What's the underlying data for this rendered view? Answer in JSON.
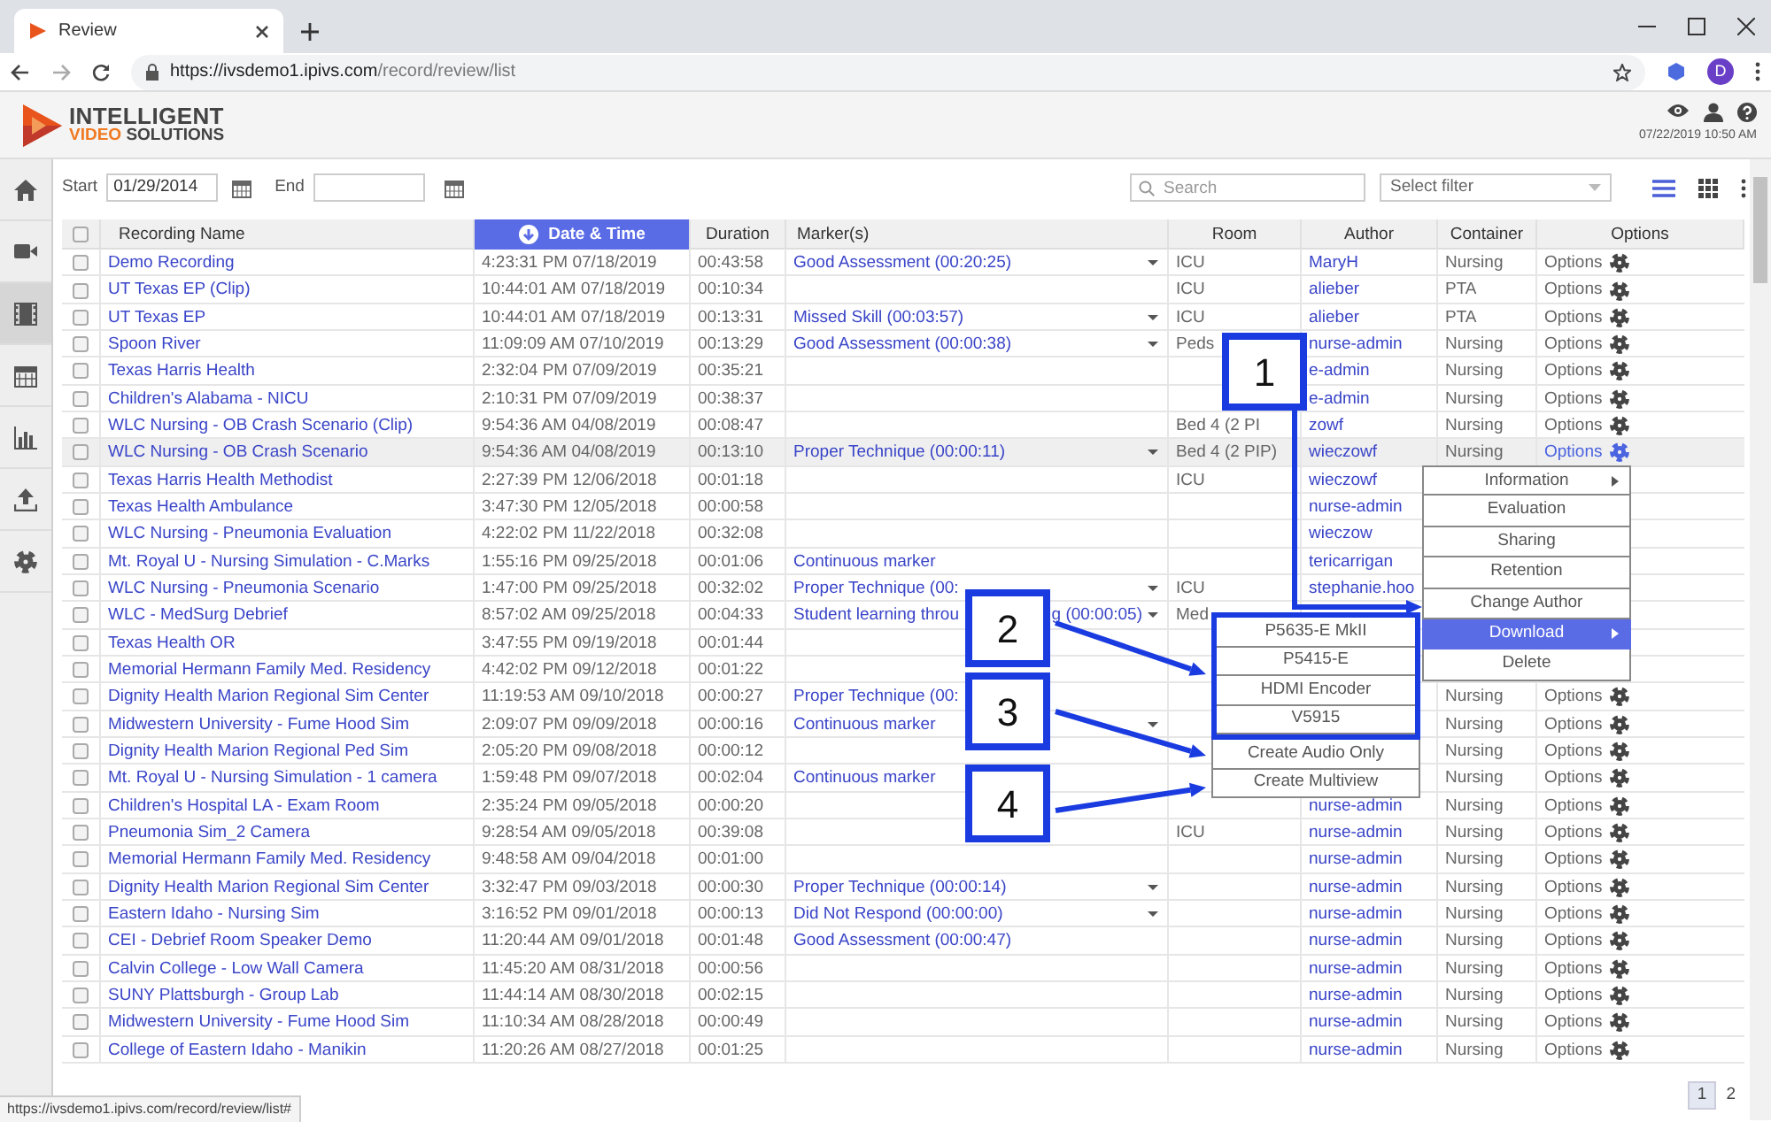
{
  "browser": {
    "tab_title": "Review",
    "url_host": "https://ivsdemo1.ipivs.com",
    "url_path": "/record/review/list",
    "profile_initial": "D"
  },
  "header": {
    "logo_line1": "INTELLIGENT",
    "logo_accent": "VIDEO",
    "logo_rest": "SOLUTIONS",
    "datetime": "07/22/2019 10:50 AM"
  },
  "sidebar": {
    "items": [
      {
        "kind": "home",
        "selected": false
      },
      {
        "kind": "video",
        "selected": false
      },
      {
        "kind": "film",
        "selected": true
      },
      {
        "kind": "calendar",
        "selected": false
      },
      {
        "kind": "chart",
        "selected": false
      },
      {
        "kind": "upload",
        "selected": false
      },
      {
        "kind": "settings",
        "selected": false
      }
    ]
  },
  "filters": {
    "start_label": "Start",
    "start_value": "01/29/2014",
    "end_label": "End",
    "search_placeholder": "Search",
    "filter_select": "Select filter",
    "view_modes": [
      {
        "kind": "list",
        "selected": true
      },
      {
        "kind": "grid",
        "selected": false
      }
    ]
  },
  "table": {
    "select_all_checked": false,
    "columns": [
      {
        "label": "Recording Name",
        "sorted": false
      },
      {
        "label": "Date & Time",
        "sorted": true
      },
      {
        "label": "Duration",
        "sorted": false
      },
      {
        "label": "Marker(s)",
        "sorted": false
      },
      {
        "label": "Room",
        "sorted": false
      },
      {
        "label": "Author",
        "sorted": false
      },
      {
        "label": "Container",
        "sorted": false
      },
      {
        "label": "Options",
        "sorted": false
      }
    ],
    "rows": [
      {
        "checked": false,
        "highlighted": false,
        "name": "Demo Recording",
        "date": "4:23:31 PM 07/18/2019",
        "duration": "00:43:58",
        "marker": "Good Assessment (00:20:25)",
        "dropdown": true,
        "room": "ICU",
        "author": "MaryH",
        "container": "Nursing",
        "options": "Options"
      },
      {
        "checked": false,
        "highlighted": false,
        "name": "UT Texas EP (Clip)",
        "date": "10:44:01 AM 07/18/2019",
        "duration": "00:10:34",
        "room": "ICU",
        "author": "alieber",
        "container": "PTA",
        "options": "Options"
      },
      {
        "checked": false,
        "highlighted": false,
        "name": "UT Texas EP",
        "date": "10:44:01 AM 07/18/2019",
        "duration": "00:13:31",
        "marker": "Missed Skill (00:03:57)",
        "dropdown": true,
        "room": "ICU",
        "author": "alieber",
        "container": "PTA",
        "options": "Options"
      },
      {
        "checked": false,
        "highlighted": false,
        "name": "Spoon River",
        "date": "11:09:09 AM 07/10/2019",
        "duration": "00:13:29",
        "marker": "Good Assessment (00:00:38)",
        "dropdown": true,
        "room": "Peds",
        "author": "nurse-admin",
        "container": "Nursing",
        "options": "Options"
      },
      {
        "checked": false,
        "highlighted": false,
        "name": "Texas Harris Health",
        "date": "2:32:04 PM 07/09/2019",
        "duration": "00:35:21",
        "author": "e-admin",
        "container": "Nursing",
        "options": "Options"
      },
      {
        "checked": false,
        "highlighted": false,
        "name": "Children's Alabama - NICU",
        "date": "2:10:31 PM 07/09/2019",
        "duration": "00:38:37",
        "author": "e-admin",
        "container": "Nursing",
        "options": "Options"
      },
      {
        "checked": false,
        "highlighted": false,
        "name": "WLC Nursing - OB Crash Scenario (Clip)",
        "date": "9:54:36 AM 04/08/2019",
        "duration": "00:08:47",
        "room": "Bed 4 (2 PI",
        "author": "zowf",
        "container": "Nursing",
        "options": "Options"
      },
      {
        "checked": false,
        "highlighted": true,
        "name": "WLC Nursing - OB Crash Scenario",
        "date": "9:54:36 AM 04/08/2019",
        "duration": "00:13:10",
        "marker": "Proper Technique (00:00:11)",
        "dropdown": true,
        "room": "Bed 4 (2 PIP)",
        "author": "wieczowf",
        "container": "Nursing",
        "options": "Options"
      },
      {
        "checked": false,
        "highlighted": false,
        "name": "Texas Harris Health Methodist",
        "date": "2:27:39 PM 12/06/2018",
        "duration": "00:01:18",
        "room": "ICU",
        "author": "wieczowf"
      },
      {
        "checked": false,
        "highlighted": false,
        "name": "Texas Health Ambulance",
        "date": "3:47:30 PM 12/05/2018",
        "duration": "00:00:58",
        "author": "nurse-admin"
      },
      {
        "checked": false,
        "highlighted": false,
        "name": "WLC Nursing - Pneumonia Evaluation",
        "date": "4:22:02 PM 11/22/2018",
        "duration": "00:32:08",
        "author": "wieczow"
      },
      {
        "checked": false,
        "highlighted": false,
        "name": "Mt. Royal U - Nursing Simulation - C.Marks",
        "date": "1:55:16 PM 09/25/2018",
        "duration": "00:01:06",
        "marker": "Continuous marker",
        "dropdown": false,
        "author": "tericarrigan"
      },
      {
        "checked": false,
        "highlighted": false,
        "name": "WLC Nursing - Pneumonia Scenario",
        "date": "1:47:00 PM 09/25/2018",
        "duration": "00:32:02",
        "marker": "Proper Technique (00:",
        "dropdown": true,
        "room": "ICU",
        "author": "stephanie.hoo"
      },
      {
        "checked": false,
        "highlighted": false,
        "name": "WLC - MedSurg Debrief",
        "date": "8:57:02 AM 09/25/2018",
        "duration": "00:04:33",
        "marker": "Student learning throu",
        "marker_end": "g (00:00:05)",
        "dropdown": true,
        "room": "Med"
      },
      {
        "checked": false,
        "highlighted": false,
        "name": "Texas Health OR",
        "date": "3:47:55 PM 09/19/2018",
        "duration": "00:01:44"
      },
      {
        "checked": false,
        "highlighted": false,
        "name": "Memorial Hermann Family Med. Residency",
        "date": "4:42:02 PM 09/12/2018",
        "duration": "00:01:22"
      },
      {
        "checked": false,
        "highlighted": false,
        "name": "Dignity Health Marion Regional Sim Center",
        "date": "11:19:53 AM 09/10/2018",
        "duration": "00:00:27",
        "marker": "Proper Technique (00:",
        "dropdown": false,
        "container": "Nursing",
        "options": "Options"
      },
      {
        "checked": false,
        "highlighted": false,
        "name": "Midwestern University - Fume Hood Sim",
        "date": "2:09:07 PM 09/09/2018",
        "duration": "00:00:16",
        "marker": "Continuous marker",
        "dropdown": true,
        "container": "Nursing",
        "options": "Options"
      },
      {
        "checked": false,
        "highlighted": false,
        "name": "Dignity Health Marion Regional Ped Sim",
        "date": "2:05:20 PM 09/08/2018",
        "duration": "00:00:12",
        "container": "Nursing",
        "options": "Options"
      },
      {
        "checked": false,
        "highlighted": false,
        "name": "Mt. Royal U - Nursing Simulation - 1 camera",
        "date": "1:59:48 PM 09/07/2018",
        "duration": "00:02:04",
        "marker": "Continuous marker",
        "dropdown": false,
        "container": "Nursing",
        "options": "Options"
      },
      {
        "checked": false,
        "highlighted": false,
        "name": "Children's Hospital LA - Exam Room",
        "date": "2:35:24 PM 09/05/2018",
        "duration": "00:00:20",
        "author": "nurse-admin",
        "container": "Nursing",
        "options": "Options"
      },
      {
        "checked": false,
        "highlighted": false,
        "name": "Pneumonia Sim_2 Camera",
        "date": "9:28:54 AM 09/05/2018",
        "duration": "00:39:08",
        "room": "ICU",
        "author": "nurse-admin",
        "container": "Nursing",
        "options": "Options"
      },
      {
        "checked": false,
        "highlighted": false,
        "name": "Memorial Hermann Family Med. Residency",
        "date": "9:48:58 AM 09/04/2018",
        "duration": "00:01:00",
        "author": "nurse-admin",
        "container": "Nursing",
        "options": "Options"
      },
      {
        "checked": false,
        "highlighted": false,
        "name": "Dignity Health Marion Regional Sim Center",
        "date": "3:32:47 PM 09/03/2018",
        "duration": "00:00:30",
        "marker": "Proper Technique (00:00:14)",
        "dropdown": true,
        "author": "nurse-admin",
        "container": "Nursing",
        "options": "Options"
      },
      {
        "checked": false,
        "highlighted": false,
        "name": "Eastern Idaho - Nursing Sim",
        "date": "3:16:52 PM 09/01/2018",
        "duration": "00:00:13",
        "marker": "Did Not Respond (00:00:00)",
        "dropdown": true,
        "author": "nurse-admin",
        "container": "Nursing",
        "options": "Options"
      },
      {
        "checked": false,
        "highlighted": false,
        "name": "CEI - Debrief Room Speaker Demo",
        "date": "11:20:44 AM 09/01/2018",
        "duration": "00:01:48",
        "marker": "Good Assessment (00:00:47)",
        "dropdown": false,
        "author": "nurse-admin",
        "container": "Nursing",
        "options": "Options"
      },
      {
        "checked": false,
        "highlighted": false,
        "name": "Calvin College - Low Wall Camera",
        "date": "11:45:20 AM 08/31/2018",
        "duration": "00:00:56",
        "author": "nurse-admin",
        "container": "Nursing",
        "options": "Options"
      },
      {
        "checked": false,
        "highlighted": false,
        "name": "SUNY Plattsburgh - Group Lab",
        "date": "11:44:14 AM 08/30/2018",
        "duration": "00:02:15",
        "author": "nurse-admin",
        "container": "Nursing",
        "options": "Options"
      },
      {
        "checked": false,
        "highlighted": false,
        "name": "Midwestern University - Fume Hood Sim",
        "date": "11:10:34 AM 08/28/2018",
        "duration": "00:00:49",
        "author": "nurse-admin",
        "container": "Nursing",
        "options": "Options"
      },
      {
        "checked": false,
        "highlighted": false,
        "name": "College of Eastern Idaho - Manikin",
        "date": "11:20:26 AM 08/27/2018",
        "duration": "00:01:25",
        "author": "nurse-admin",
        "container": "Nursing",
        "options": "Options"
      }
    ]
  },
  "context_menu": {
    "items": [
      {
        "label": "Information",
        "submenu": true,
        "selected": false
      },
      {
        "label": "Evaluation",
        "submenu": false,
        "selected": false
      },
      {
        "label": "Sharing",
        "submenu": false,
        "selected": false
      },
      {
        "label": "Retention",
        "submenu": false,
        "selected": false
      },
      {
        "label": "Change Author",
        "submenu": false,
        "selected": false
      },
      {
        "label": "Download",
        "submenu": true,
        "selected": true
      },
      {
        "label": "Delete",
        "submenu": false,
        "selected": false
      }
    ]
  },
  "download_menu": {
    "items": [
      {
        "label": "P5635-E MkII",
        "framed": true
      },
      {
        "label": "P5415-E",
        "framed": true
      },
      {
        "label": "HDMI Encoder",
        "framed": true
      },
      {
        "label": "V5915",
        "framed": true
      },
      {
        "label": "Create Audio Only",
        "framed": false
      },
      {
        "label": "Create Multiview",
        "framed": false
      }
    ]
  },
  "callouts": [
    {
      "number": "1"
    },
    {
      "number": "2"
    },
    {
      "number": "3"
    },
    {
      "number": "4"
    }
  ],
  "pagination": {
    "pages": [
      {
        "label": "1",
        "selected": true
      },
      {
        "label": "2",
        "selected": false
      }
    ]
  },
  "status_url": "https://ivsdemo1.ipivs.com/record/review/list#"
}
